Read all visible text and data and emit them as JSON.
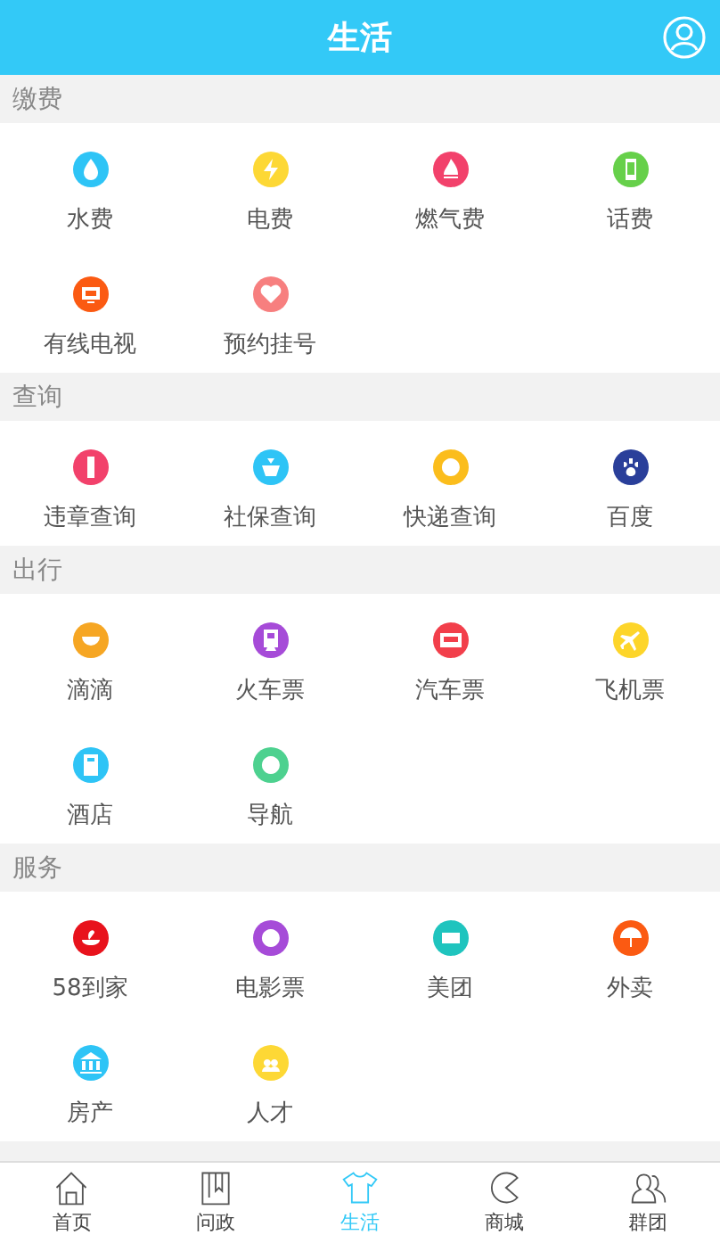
{
  "header": {
    "title": "生活"
  },
  "sections": [
    {
      "title": "缴费",
      "items": [
        {
          "label": "水费",
          "color": "#2ec4f6"
        },
        {
          "label": "电费",
          "color": "#fdd835"
        },
        {
          "label": "燃气费",
          "color": "#f2416b"
        },
        {
          "label": "话费",
          "color": "#66d04a"
        },
        {
          "label": "有线电视",
          "color": "#fb5a12"
        },
        {
          "label": "预约挂号",
          "color": "#f77f7f"
        }
      ]
    },
    {
      "title": "查询",
      "items": [
        {
          "label": "违章查询",
          "color": "#f2416b"
        },
        {
          "label": "社保查询",
          "color": "#2ec4f6"
        },
        {
          "label": "快递查询",
          "color": "#fbbd1c"
        },
        {
          "label": "百度",
          "color": "#2a3f9a"
        }
      ]
    },
    {
      "title": "出行",
      "items": [
        {
          "label": "滴滴",
          "color": "#f6a623"
        },
        {
          "label": "火车票",
          "color": "#a64bd8"
        },
        {
          "label": "汽车票",
          "color": "#f23f4b"
        },
        {
          "label": "飞机票",
          "color": "#fdd52a"
        },
        {
          "label": "酒店",
          "color": "#2ec4f6"
        },
        {
          "label": "导航",
          "color": "#4dd18f"
        }
      ]
    },
    {
      "title": "服务",
      "items": [
        {
          "label": "58到家",
          "color": "#e8121c"
        },
        {
          "label": "电影票",
          "color": "#a64bd8"
        },
        {
          "label": "美团",
          "color": "#1fc4be"
        },
        {
          "label": "外卖",
          "color": "#fb5a12"
        },
        {
          "label": "房产",
          "color": "#2ec4f6"
        },
        {
          "label": "人才",
          "color": "#fdd835"
        }
      ]
    }
  ],
  "tabs": [
    {
      "label": "首页",
      "selected": false
    },
    {
      "label": "问政",
      "selected": false
    },
    {
      "label": "生活",
      "selected": true
    },
    {
      "label": "商城",
      "selected": false
    },
    {
      "label": "群团",
      "selected": false
    }
  ]
}
